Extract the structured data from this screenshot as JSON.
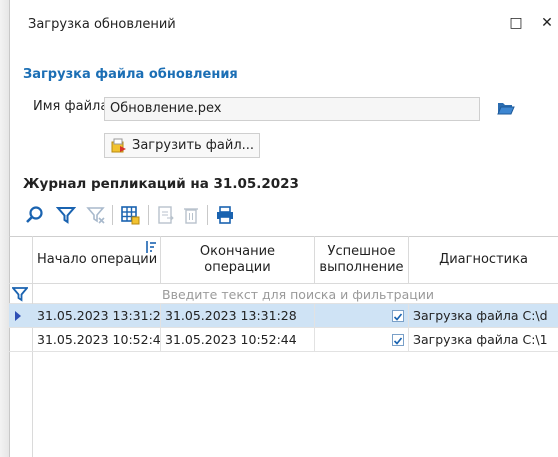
{
  "window": {
    "title": "Загрузка обновлений",
    "maximize_glyph": "□",
    "close_glyph": "✕"
  },
  "upload": {
    "section_title": "Загрузка файла обновления",
    "file_label": "Имя файла",
    "file_value": "Обновление.pex",
    "load_button": "Загрузить файл..."
  },
  "journal": {
    "title": "Журнал репликаций на 31.05.2023",
    "toolbar": [
      "search-icon",
      "filter-icon",
      "clear-filter-icon",
      "columns-icon",
      "export-icon",
      "delete-icon",
      "print-icon"
    ],
    "columns": [
      "Начало операции",
      "Окончание операции",
      "Успешное выполнение",
      "Диагностика"
    ],
    "filter_placeholder": "Введите текст для поиска и фильтрации",
    "rows": [
      {
        "start": "31.05.2023 13:31:2",
        "end": "31.05.2023 13:31:28",
        "success": true,
        "diag": "Загрузка файла C:\\d",
        "selected": true
      },
      {
        "start": "31.05.2023 10:52:4",
        "end": "31.05.2023 10:52:44",
        "success": true,
        "diag": "Загрузка файла C:\\1",
        "selected": false
      }
    ]
  },
  "colors": {
    "accent": "#1c6fb5",
    "selected_row": "#cfe3f5",
    "icon_blue": "#1a63b0"
  }
}
